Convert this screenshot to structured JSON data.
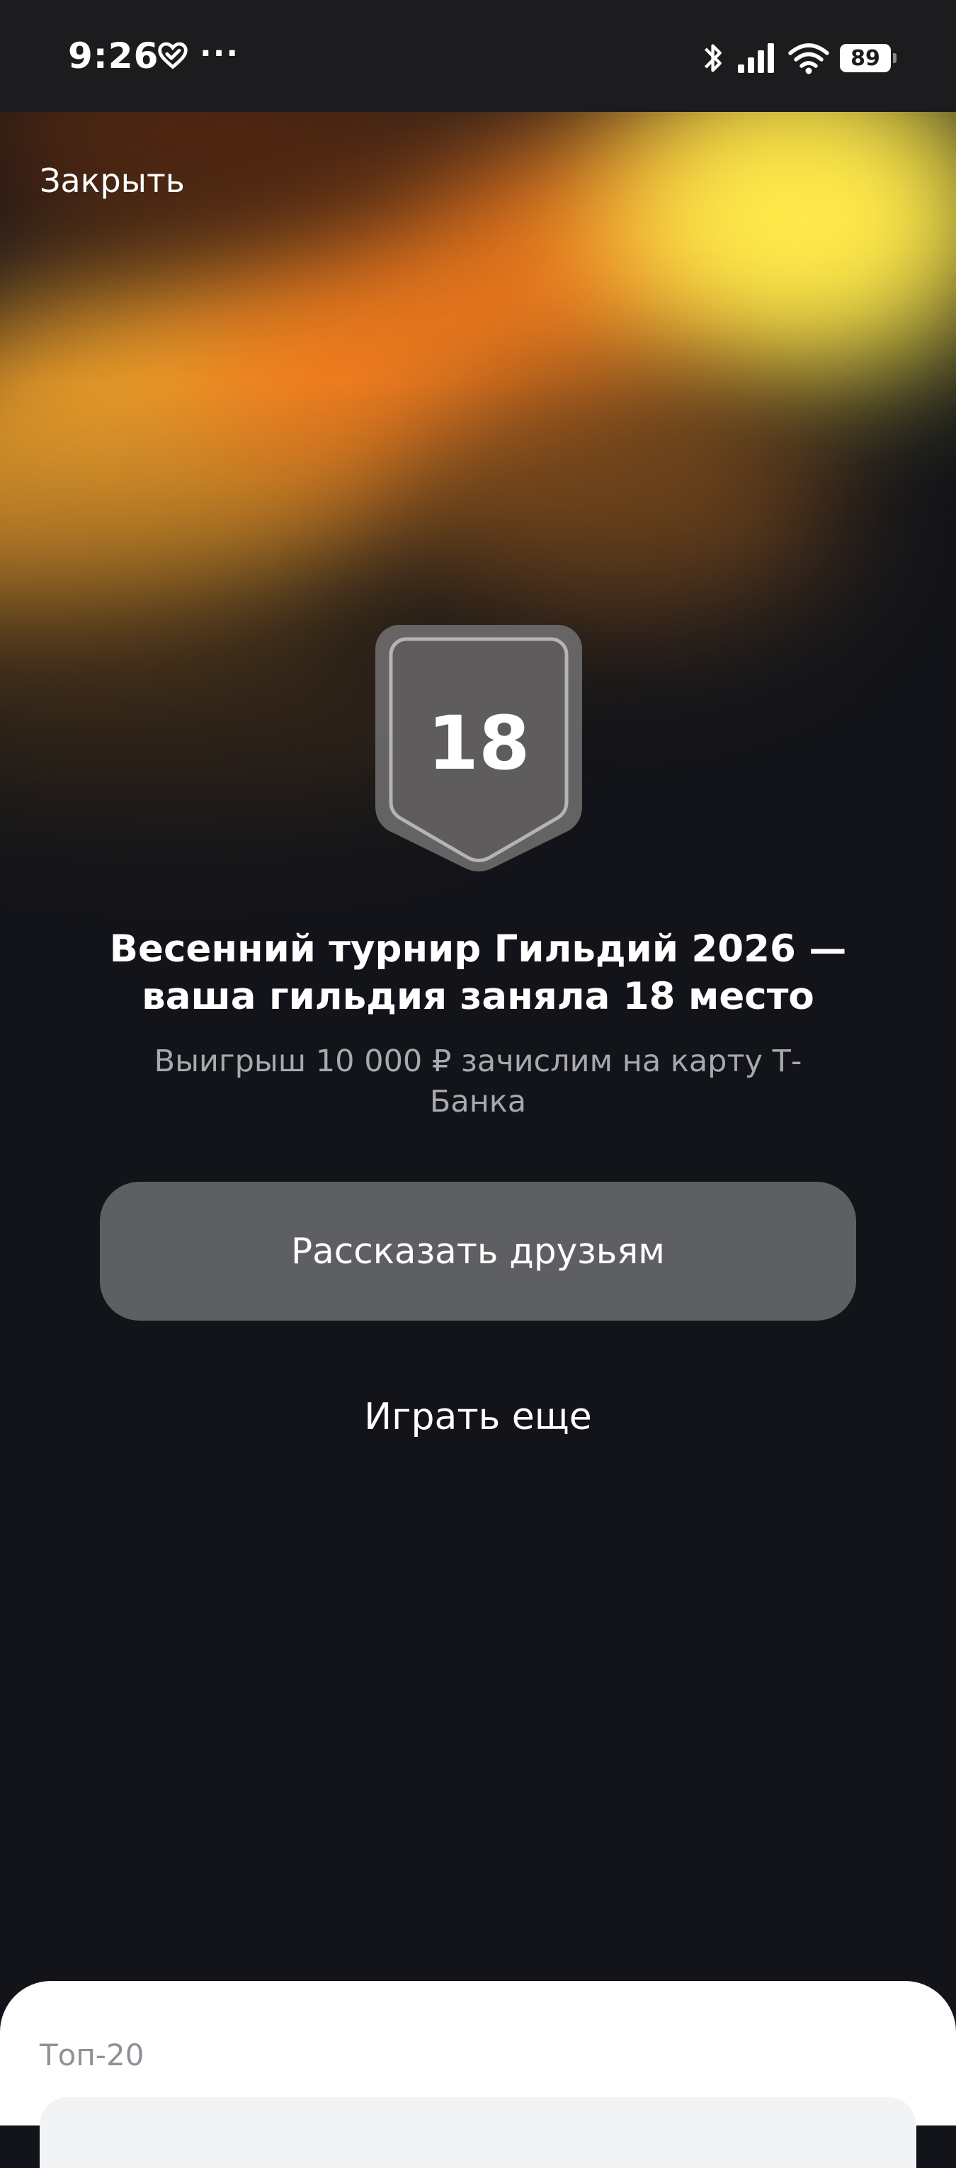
{
  "status_bar": {
    "time": "9:26",
    "extra": "···",
    "battery": "89",
    "icons": [
      "heart-check-icon",
      "bluetooth-icon",
      "signal-icon",
      "wifi-icon",
      "battery-icon"
    ]
  },
  "header": {
    "close_label": "Закрыть"
  },
  "result": {
    "place": "18",
    "title": "Весенний турнир Гильдий 2026 — ваша гильдия заняла 18 место",
    "subtitle": "Выигрыш 10 000 ₽ зачислим на карту Т-Банка"
  },
  "actions": {
    "share_label": "Рассказать друзьям",
    "play_again_label": "Играть еще"
  },
  "bottom_sheet": {
    "title": "Топ-20"
  },
  "colors": {
    "background": "#131419",
    "accent_yellow": "#ffe94a",
    "accent_orange": "#f58a23",
    "button_gray": "#5d5f62"
  }
}
